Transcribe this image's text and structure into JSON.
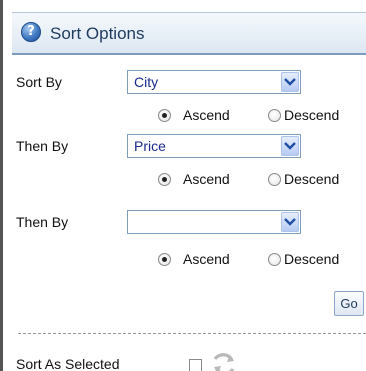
{
  "header": {
    "title": "Sort Options",
    "help_icon_glyph": "?"
  },
  "sort_rows": [
    {
      "label": "Sort By",
      "value": "City",
      "order_options": [
        "Ascend",
        "Descend"
      ],
      "order_selected": "Ascend"
    },
    {
      "label": "Then By",
      "value": "Price",
      "order_options": [
        "Ascend",
        "Descend"
      ],
      "order_selected": "Ascend"
    },
    {
      "label": "Then By",
      "value": "",
      "order_options": [
        "Ascend",
        "Descend"
      ],
      "order_selected": "Ascend"
    }
  ],
  "go_button": {
    "label": "Go"
  },
  "sort_as_selected": {
    "label": "Sort As Selected",
    "checked": false
  },
  "icons": {
    "help": "help-icon",
    "dropdown": "chevron-down-icon",
    "refresh": "refresh-icon"
  },
  "colors": {
    "header_text": "#1e3b5e",
    "select_text": "#1a2a8c",
    "header_border": "#7e9bbd"
  }
}
